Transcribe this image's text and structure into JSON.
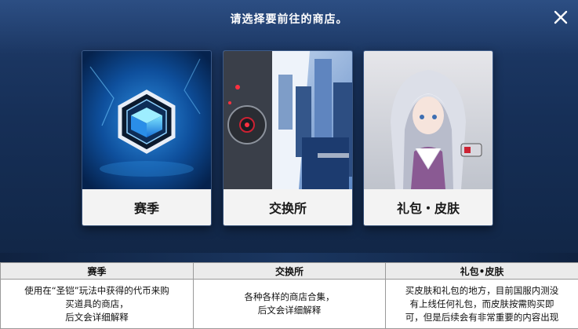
{
  "modal": {
    "title": "请选择要前往的商店。",
    "close_icon": "close-icon"
  },
  "cards": [
    {
      "label": "赛季",
      "art": "season-hexagon-emblem"
    },
    {
      "label": "交换所",
      "art": "exchange-cityscape-art"
    },
    {
      "label": "礼包・皮肤",
      "art": "silver-haired-character-art"
    }
  ],
  "table": {
    "headers": [
      "赛季",
      "交换所",
      "礼包•皮肤"
    ],
    "rows": [
      [
        [
          "使用在“圣铠”玩法中获得的代币来购",
          "买道具的商店，",
          "后文会详细解释"
        ],
        [
          "各种各样的商店合集，",
          "后文会详细解释"
        ],
        [
          "买皮肤和礼包的地方，目前国服内测没",
          "有上线任何礼包，而皮肤按需购买即",
          "可，但是后续会有非常重要的内容出现"
        ]
      ]
    ]
  },
  "colors": {
    "modal_bg": "#1a3560",
    "card_label_bg": "#f3f3f3",
    "season_accent": "#3aa8ff"
  }
}
